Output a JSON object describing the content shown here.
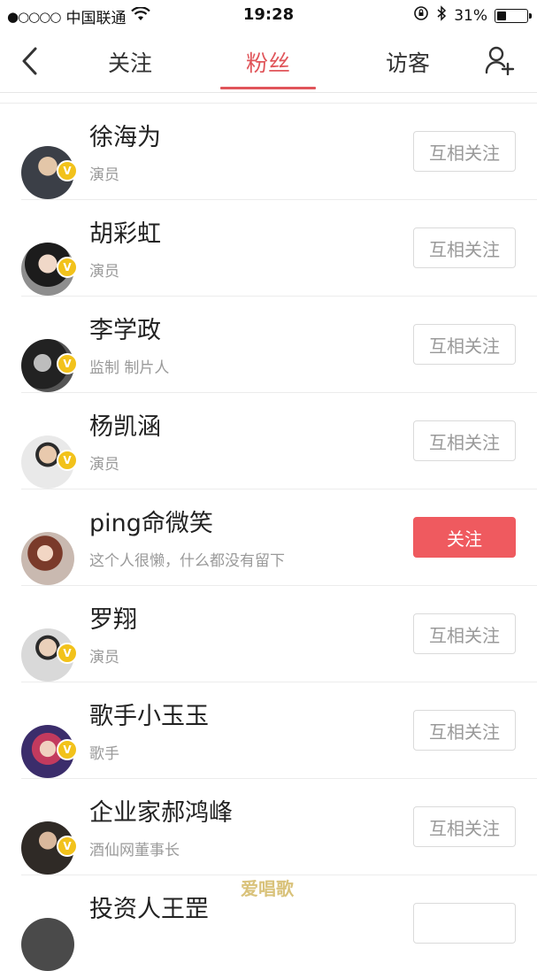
{
  "status_bar": {
    "signal": "●○○○○",
    "carrier": "中国联通",
    "time": "19:28",
    "battery_percent": "31%",
    "battery_level": 0.31
  },
  "nav": {
    "tabs": [
      {
        "label": "关注",
        "active": false
      },
      {
        "label": "粉丝",
        "active": true
      },
      {
        "label": "访客",
        "active": false
      }
    ]
  },
  "colors": {
    "accent": "#e0555a",
    "follow_button": "#ef5a5f",
    "verified_badge": "#f2c21b"
  },
  "followers": [
    {
      "name": "徐海为",
      "desc": "演员",
      "button": "互相关注",
      "verified": true,
      "avatar_color": "#3b3f47"
    },
    {
      "name": "胡彩虹",
      "desc": "演员",
      "button": "互相关注",
      "verified": true,
      "avatar_color": "#6a6a6a"
    },
    {
      "name": "李学政",
      "desc": "监制 制片人",
      "button": "互相关注",
      "verified": true,
      "avatar_color": "#2a2a2a"
    },
    {
      "name": "杨凯涵",
      "desc": "演员",
      "button": "互相关注",
      "verified": true,
      "avatar_color": "#8a8a8a"
    },
    {
      "name": "ping命微笑",
      "desc": "这个人很懒，什么都没有留下",
      "button": "关注",
      "verified": false,
      "avatar_color": "#a44c4c"
    },
    {
      "name": "罗翔",
      "desc": "演员",
      "button": "互相关注",
      "verified": true,
      "avatar_color": "#555a60"
    },
    {
      "name": "歌手小玉玉",
      "desc": "歌手",
      "button": "互相关注",
      "verified": true,
      "avatar_color": "#4a3b6b"
    },
    {
      "name": "企业家郝鸿峰",
      "desc": "酒仙网董事长",
      "button": "互相关注",
      "verified": true,
      "avatar_color": "#4b4038"
    }
  ],
  "partial_follower": {
    "name": "投资人王罡"
  },
  "watermark": "爱唱歌"
}
